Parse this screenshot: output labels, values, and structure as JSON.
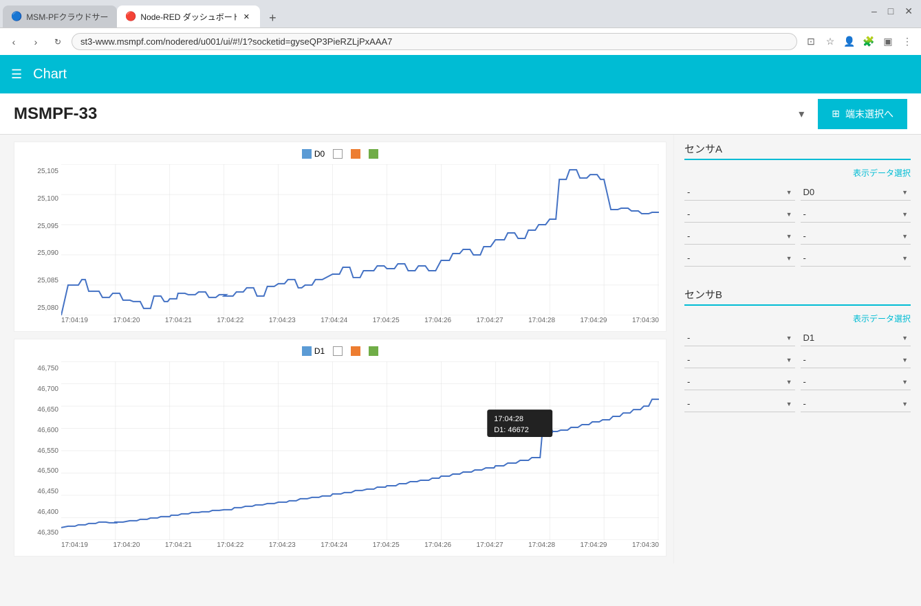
{
  "browser": {
    "tabs": [
      {
        "id": "tab1",
        "label": "MSM-PFクラウドサービス",
        "active": false,
        "favicon": "🔵"
      },
      {
        "id": "tab2",
        "label": "Node-RED ダッシュボード",
        "active": true,
        "favicon": "🔴"
      }
    ],
    "address": "st3-www.msmpf.com/nodered/u001/ui/#!/1?socketid=gyseQP3PieRZLjPxAAA7",
    "new_tab_label": "+",
    "window_controls": [
      "–",
      "□",
      "✕"
    ]
  },
  "app": {
    "header": {
      "menu_icon": "☰",
      "title": "Chart"
    },
    "device": {
      "title": "MSMPF-33",
      "dropdown_icon": "▾",
      "button_label": "端末選択へ",
      "button_icon": "⊞"
    },
    "charts": [
      {
        "id": "chart1",
        "legend": [
          {
            "id": "D0",
            "label": "D0",
            "color": "blue"
          },
          {
            "id": "L1",
            "label": "",
            "color": "white"
          },
          {
            "id": "L2",
            "label": "",
            "color": "orange"
          },
          {
            "id": "L3",
            "label": "",
            "color": "green"
          }
        ],
        "y_labels": [
          "25,105",
          "25,100",
          "25,095",
          "25,090",
          "25,085",
          "25,080"
        ],
        "x_labels": [
          "17:04:19",
          "17:04:20",
          "17:04:21",
          "17:04:22",
          "17:04:23",
          "17:04:24",
          "17:04:25",
          "17:04:26",
          "17:04:27",
          "17:04:28",
          "17:04:29",
          "17:04:30"
        ],
        "tooltip": null
      },
      {
        "id": "chart2",
        "legend": [
          {
            "id": "D1",
            "label": "D1",
            "color": "blue"
          },
          {
            "id": "L1",
            "label": "",
            "color": "white"
          },
          {
            "id": "L2",
            "label": "",
            "color": "orange"
          },
          {
            "id": "L3",
            "label": "",
            "color": "green"
          }
        ],
        "y_labels": [
          "46,750",
          "46,700",
          "46,650",
          "46,600",
          "46,550",
          "46,500",
          "46,450",
          "46,400",
          "46,350"
        ],
        "x_labels": [
          "17:04:19",
          "17:04:20",
          "17:04:21",
          "17:04:22",
          "17:04:23",
          "17:04:24",
          "17:04:25",
          "17:04:26",
          "17:04:27",
          "17:04:28",
          "17:04:29",
          "17:04:30"
        ],
        "tooltip": {
          "time": "17:04:28",
          "value": "D1: 46672"
        }
      }
    ],
    "sensors": [
      {
        "id": "sensorA",
        "title": "センサA",
        "data_select_label": "表示データ選択",
        "rows": [
          {
            "left_val": "-",
            "right_val": "D0"
          },
          {
            "left_val": "-",
            "right_val": "-"
          },
          {
            "left_val": "-",
            "right_val": "-"
          },
          {
            "left_val": "-",
            "right_val": "-"
          }
        ]
      },
      {
        "id": "sensorB",
        "title": "センサB",
        "data_select_label": "表示データ選択",
        "rows": [
          {
            "left_val": "-",
            "right_val": "D1"
          },
          {
            "left_val": "-",
            "right_val": "-"
          },
          {
            "left_val": "-",
            "right_val": "-"
          },
          {
            "left_val": "-",
            "right_val": "-"
          }
        ]
      }
    ]
  }
}
